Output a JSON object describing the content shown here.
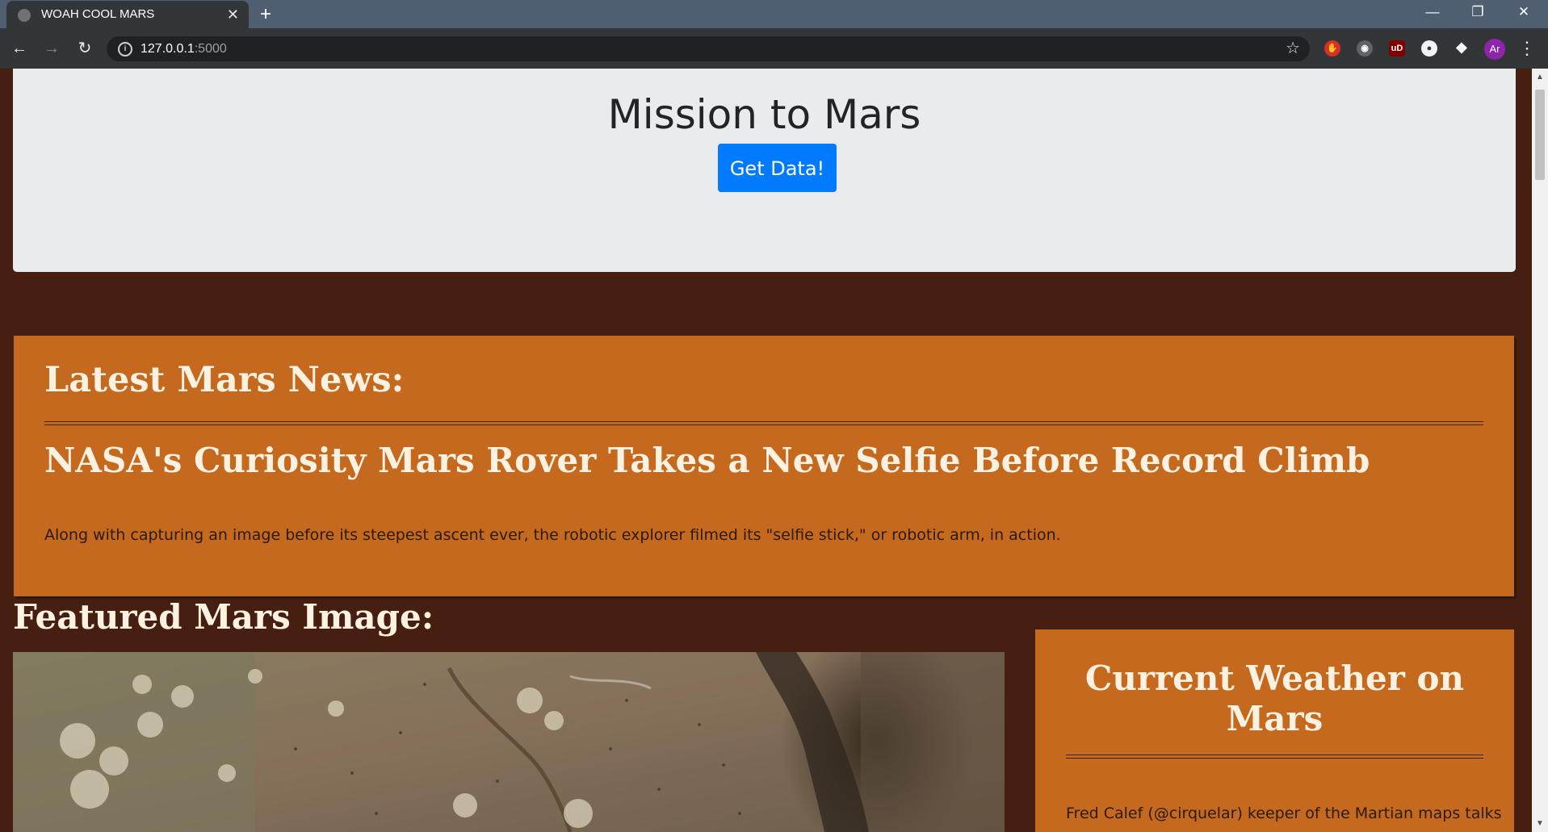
{
  "browser": {
    "tab_title": "WOAH COOL MARS",
    "tab_close": "✕",
    "new_tab": "+",
    "url_host": "127.0.0.1",
    "url_port": ":5000",
    "avatar_initials": "Ar"
  },
  "jumbotron": {
    "title": "Mission to Mars",
    "button_label": "Get Data!"
  },
  "news": {
    "heading": "Latest Mars News:",
    "title": "NASA's Curiosity Mars Rover Takes a New Selfie Before Record Climb",
    "teaser": "Along with capturing an image before its steepest ascent ever, the robotic explorer filmed its \"selfie stick,\" or robotic arm, in action."
  },
  "featured": {
    "heading": "Featured Mars Image:"
  },
  "weather": {
    "heading": "Current Weather on Mars",
    "text": "Fred Calef (@cirquelar) keeper of the Martian maps talks"
  },
  "colors": {
    "background": "#461f11",
    "panel": "#c4691e",
    "jumbotron": "#e9ecef",
    "button": "#007bff",
    "heading_text": "#fdf1e1"
  },
  "icons": [
    "back-arrow-icon",
    "forward-arrow-icon",
    "reload-icon",
    "info-icon",
    "star-icon",
    "extensions-icon",
    "menu-icon"
  ]
}
